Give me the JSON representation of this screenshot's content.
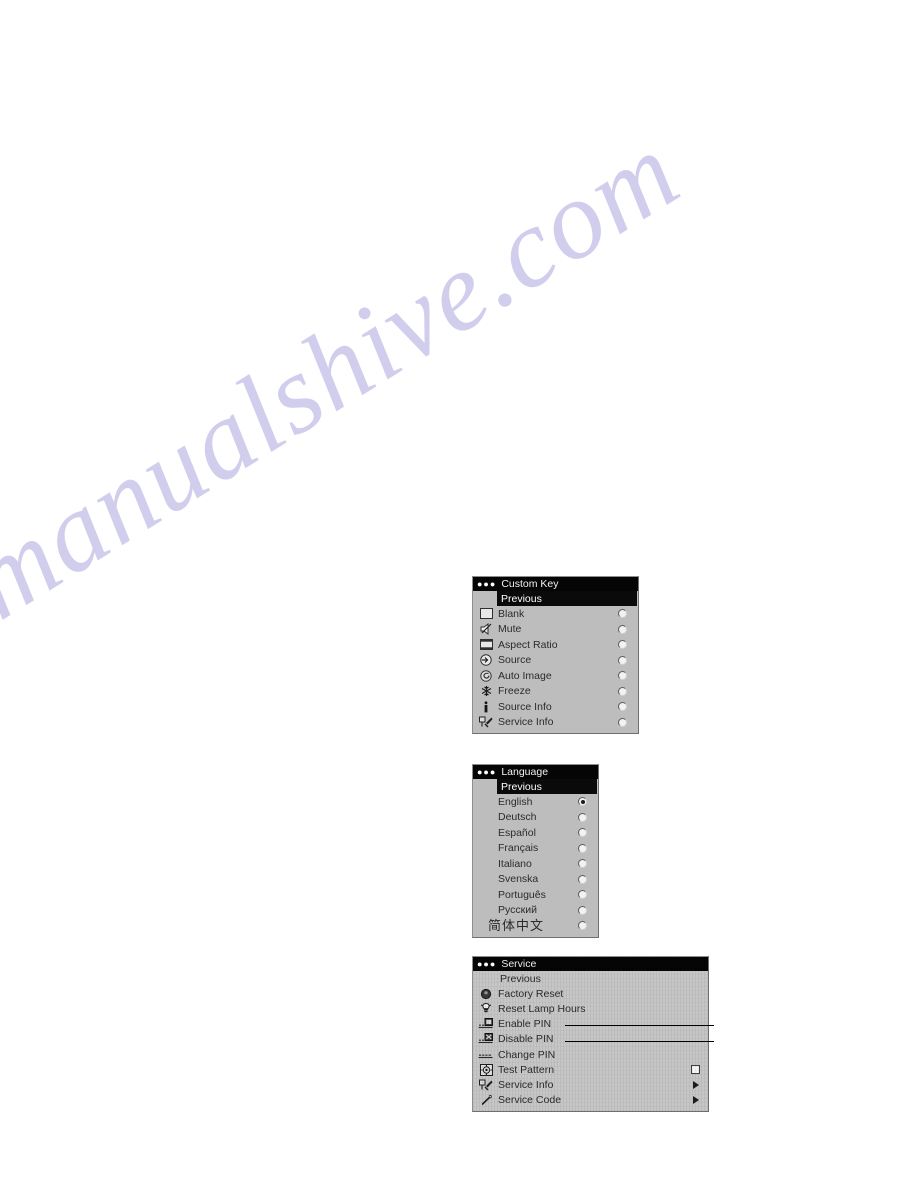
{
  "page": {
    "background_color": "#ffffff",
    "watermark_text": "manualshive.com",
    "watermark_color": "#c9c6ea"
  },
  "menus": {
    "custom_key": {
      "title": "Custom Key",
      "previous_label": "Previous",
      "items": [
        {
          "label": "Blank",
          "icon": "blank-screen-icon",
          "control": "radio",
          "selected": false
        },
        {
          "label": "Mute",
          "icon": "mute-speaker-icon",
          "control": "radio",
          "selected": false
        },
        {
          "label": "Aspect Ratio",
          "icon": "aspect-ratio-icon",
          "control": "radio",
          "selected": false
        },
        {
          "label": "Source",
          "icon": "source-arrow-icon",
          "control": "radio",
          "selected": false
        },
        {
          "label": "Auto Image",
          "icon": "auto-image-icon",
          "control": "radio",
          "selected": false
        },
        {
          "label": "Freeze",
          "icon": "freeze-snowflake-icon",
          "control": "radio",
          "selected": false
        },
        {
          "label": "Source Info",
          "icon": "info-i-icon",
          "control": "radio",
          "selected": false
        },
        {
          "label": "Service Info",
          "icon": "service-wrench-icon",
          "control": "radio",
          "selected": false
        }
      ]
    },
    "language": {
      "title": "Language",
      "previous_label": "Previous",
      "items": [
        {
          "label": "English",
          "control": "radio",
          "selected": true
        },
        {
          "label": "Deutsch",
          "control": "radio",
          "selected": false
        },
        {
          "label": "Español",
          "control": "radio",
          "selected": false
        },
        {
          "label": "Français",
          "control": "radio",
          "selected": false
        },
        {
          "label": "Italiano",
          "control": "radio",
          "selected": false
        },
        {
          "label": "Svenska",
          "control": "radio",
          "selected": false
        },
        {
          "label": "Português",
          "control": "radio",
          "selected": false
        },
        {
          "label": "Русский",
          "control": "radio",
          "selected": false
        },
        {
          "label": "简体中文",
          "control": "radio",
          "selected": false
        }
      ]
    },
    "service": {
      "title": "Service",
      "previous_label": "Previous",
      "items": [
        {
          "label": "Factory Reset",
          "icon": "factory-reset-icon",
          "control": "none"
        },
        {
          "label": "Reset Lamp Hours",
          "icon": "lamp-icon",
          "control": "none"
        },
        {
          "label": "Enable PIN",
          "icon": "enable-pin-icon",
          "control": "none"
        },
        {
          "label": "Disable PIN",
          "icon": "disable-pin-icon",
          "control": "none"
        },
        {
          "label": "Change PIN",
          "icon": "change-pin-icon",
          "control": "none"
        },
        {
          "label": "Test Pattern",
          "icon": "test-pattern-icon",
          "control": "checkbox",
          "checked": false
        },
        {
          "label": "Service Info",
          "icon": "service-wrench-icon",
          "control": "arrow"
        },
        {
          "label": "Service Code",
          "icon": "service-code-icon",
          "control": "arrow"
        }
      ]
    }
  },
  "callouts": [
    {
      "name": "enable-pin-leader",
      "target": "Enable PIN"
    },
    {
      "name": "disable-pin-leader",
      "target": "Disable PIN"
    }
  ]
}
